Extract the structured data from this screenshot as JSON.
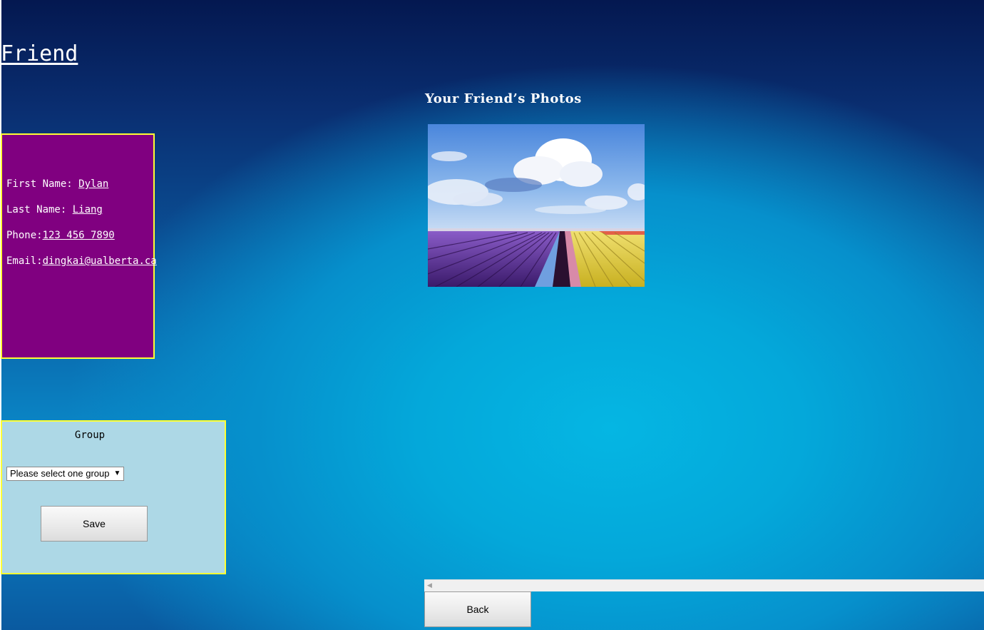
{
  "page": {
    "title": "Friend",
    "photos_heading": "Your Friend’s Photos"
  },
  "profile": {
    "first_name_label": "First Name: ",
    "first_name": "Dylan",
    "last_name_label": "Last Name: ",
    "last_name": "Liang",
    "phone_label": "Phone:",
    "phone": "123 456 7890",
    "email_label": "Email:",
    "email": "dingkai@ualberta.ca",
    "panel_color": "#800080",
    "border_color": "#ffff33"
  },
  "photos": [
    {
      "icon": "tulip-field-photo"
    }
  ],
  "group": {
    "label": "Group",
    "select_value": "Please select one group",
    "save_label": "Save",
    "panel_color": "#add8e6"
  },
  "footer": {
    "back_label": "Back",
    "scroll_arrow_icon": "scroll-left-arrow-icon"
  }
}
